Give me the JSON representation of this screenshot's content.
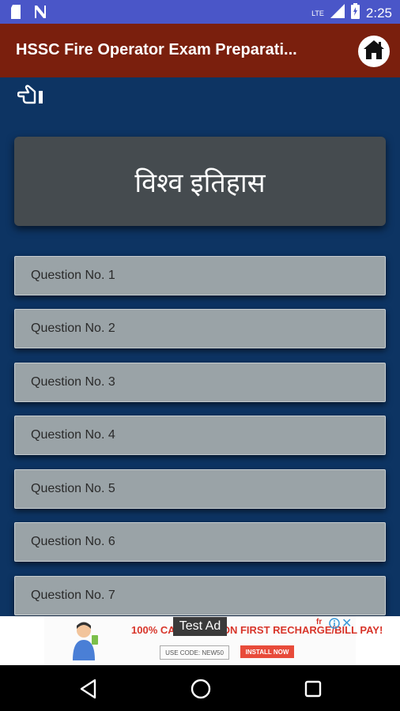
{
  "status_bar": {
    "time": "2:25",
    "network_label": "LTE",
    "icons": [
      "sd-card-icon",
      "n-notification-icon",
      "signal-icon",
      "battery-icon"
    ]
  },
  "app_bar": {
    "title": "HSSC Fire Operator Exam Preparati...",
    "home_icon": "home-icon",
    "color": "#7a1f0d"
  },
  "toolbar": {
    "back_icon": "hand-pointing-back-icon"
  },
  "topic": {
    "title": "विश्व इतिहास"
  },
  "questions": [
    {
      "label": "Question No. 1"
    },
    {
      "label": "Question No. 2"
    },
    {
      "label": "Question No. 3"
    },
    {
      "label": "Question No. 4"
    },
    {
      "label": "Question No. 5"
    },
    {
      "label": "Question No. 6"
    },
    {
      "label": "Question No. 7"
    }
  ],
  "ad": {
    "badge": "Test Ad",
    "headline": "100% CASHBACK ON FIRST RECHARGE/BILL PAY!",
    "code_label": "USE CODE: NEW50",
    "install_label": "INSTALL NOW"
  },
  "nav_bar": {
    "icons": [
      "back-triangle-icon",
      "home-circle-icon",
      "recents-square-icon"
    ]
  },
  "colors": {
    "status_bar": "#4a56c8",
    "background": "#0d3463",
    "topic_card": "#454b4f",
    "question_item": "#9aa3a7"
  }
}
